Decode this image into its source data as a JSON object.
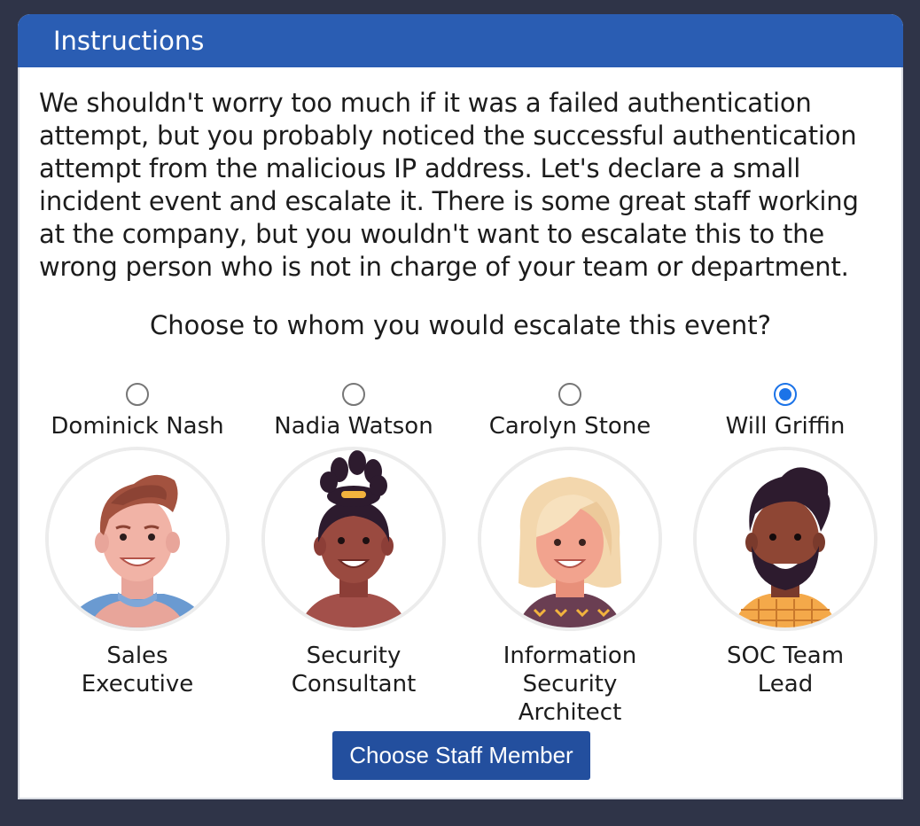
{
  "panel": {
    "title": "Instructions"
  },
  "intro_text": "We shouldn't worry too much if it was a failed authentication attempt, but you probably noticed the successful authentication attempt from the malicious IP address. Let's declare a small incident event and escalate it. There is some great staff working at the company, but you wouldn't want to escalate this to the wrong person who is not in charge of your team or department.",
  "question": "Choose to whom you would escalate this event?",
  "staff": [
    {
      "name": "Dominick Nash",
      "role": "Sales Executive",
      "selected": false,
      "avatar_icon": "man-brown-hair-avatar-icon"
    },
    {
      "name": "Nadia Watson",
      "role": "Security Consultant",
      "selected": false,
      "avatar_icon": "woman-hair-bun-avatar-icon"
    },
    {
      "name": "Carolyn Stone",
      "role": "Information Security Architect",
      "selected": false,
      "avatar_icon": "woman-blonde-hair-avatar-icon"
    },
    {
      "name": "Will Griffin",
      "role": "SOC Team Lead",
      "selected": true,
      "avatar_icon": "man-beard-avatar-icon"
    }
  ],
  "submit_label": "Choose Staff Member",
  "colors": {
    "header": "#2a5db3",
    "button": "#234f9e",
    "background": "#2f3448",
    "radio_selected": "#1b73e8"
  }
}
